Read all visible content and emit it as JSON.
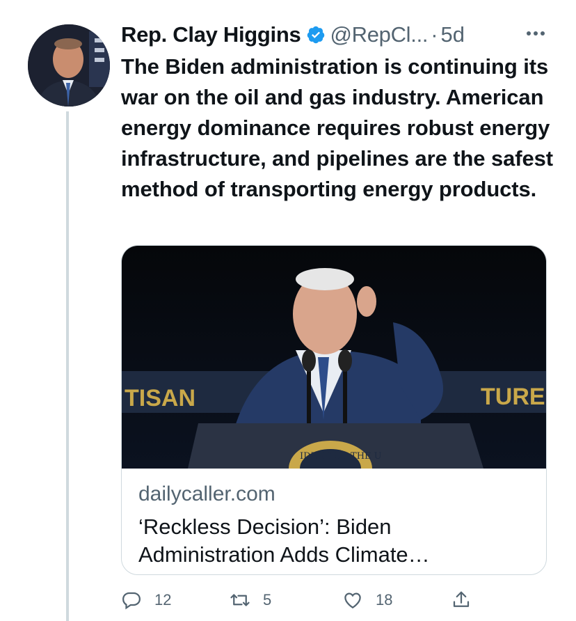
{
  "tweet": {
    "author": {
      "display_name": "Rep. Clay Higgins",
      "verified": true,
      "handle": "@RepCl...",
      "avatar_icon": "profile-photo"
    },
    "separator": "·",
    "timestamp": "5d",
    "text": "The Biden administration is continuing its war on the oil and gas industry. American energy dominance requires robust energy infrastructure, and pipelines are the safest method of transporting energy products.",
    "link_card": {
      "image_description_icon": "news-photo",
      "banner_left_text": "TISAN",
      "banner_right_text": "TURE",
      "seal_text": "IDENT OF THE U",
      "domain": "dailycaller.com",
      "title": "‘Reckless Decision’: Biden Administration Adds Climate…"
    },
    "actions": {
      "reply_count": "12",
      "retweet_count": "5",
      "like_count": "18"
    }
  },
  "colors": {
    "verified": "#1d9bf0",
    "secondary_text": "#536471",
    "border": "#cfd9de"
  }
}
